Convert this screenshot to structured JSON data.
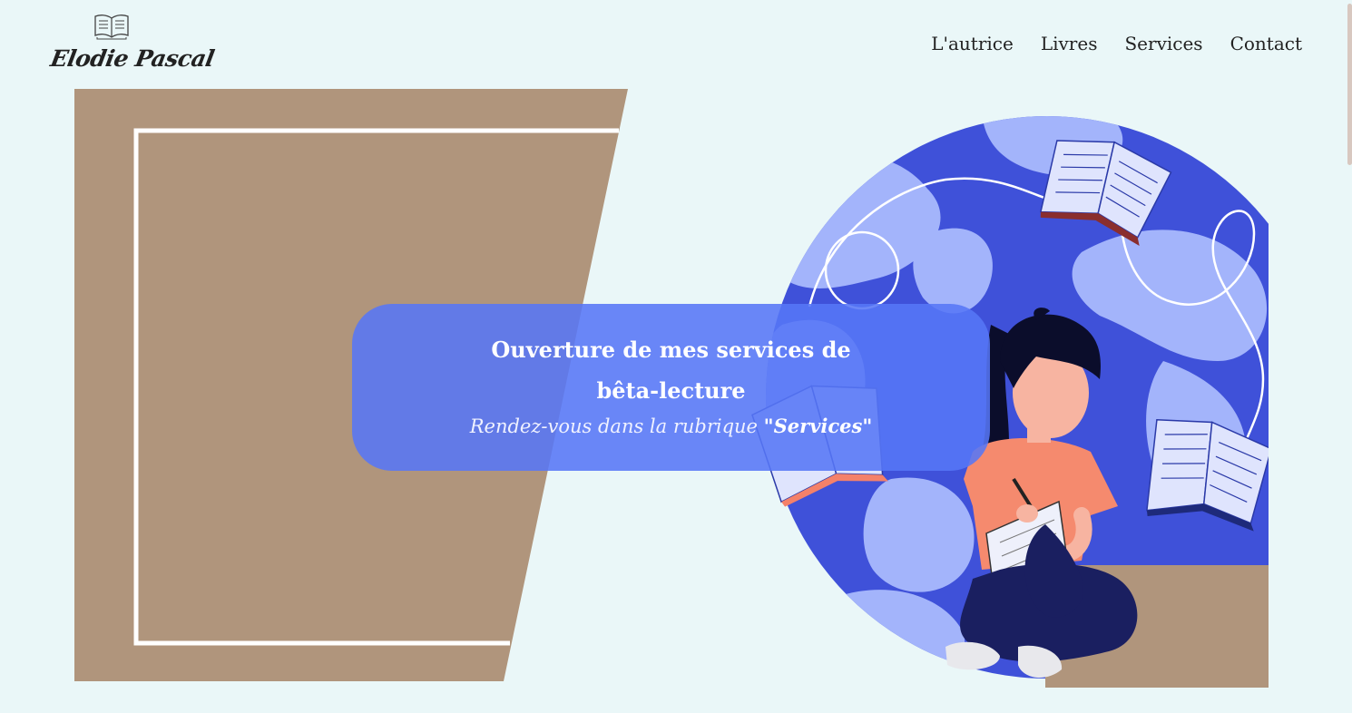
{
  "header": {
    "logo_text": "Elodie Pascal",
    "logo_icon": "open-book-icon",
    "nav": [
      {
        "label": "L'autrice"
      },
      {
        "label": "Livres"
      },
      {
        "label": "Services"
      },
      {
        "label": "Contact"
      }
    ]
  },
  "hero": {
    "title": "Ouverture de mes services de bêta-lecture",
    "subtitle_prefix": "Rendez-vous dans la rubrique ",
    "subtitle_highlight": "\"Services\"",
    "illustration": "woman-reading-writing-illustration"
  },
  "colors": {
    "background": "#eaf7f8",
    "tan": "#b0957c",
    "overlay_blue": "#5676f6",
    "globe_dark": "#3f51d9",
    "globe_light": "#a3b4fb"
  }
}
